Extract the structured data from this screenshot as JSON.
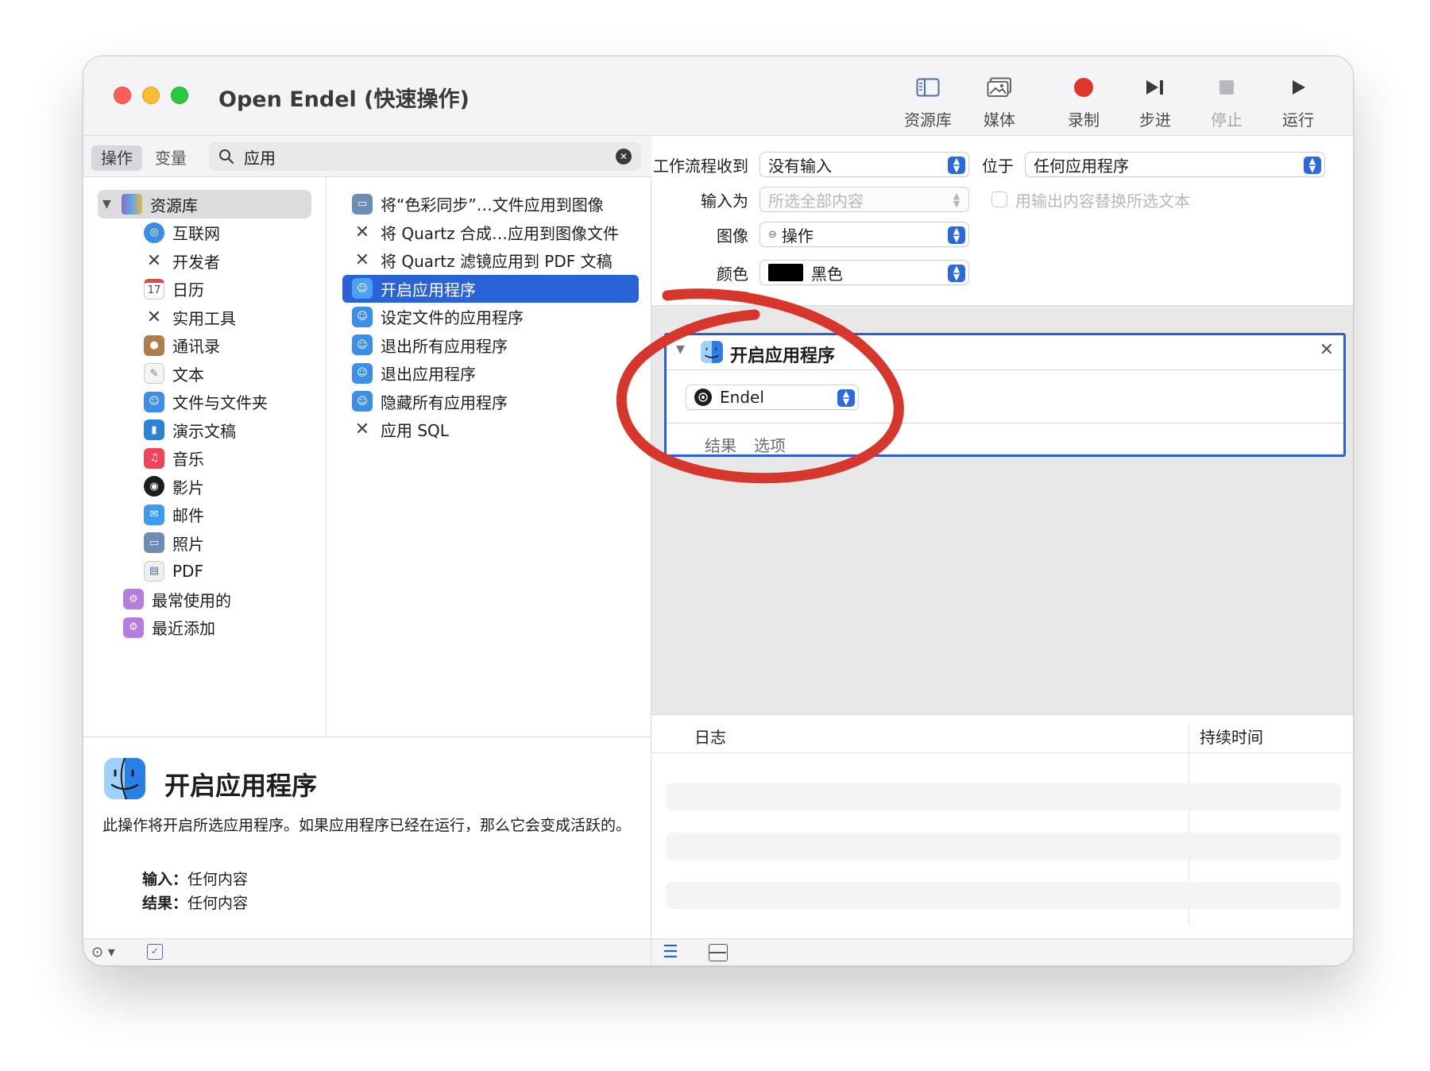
{
  "window": {
    "title": "Open Endel (快速操作)"
  },
  "toolbar": {
    "library": "资源库",
    "media": "媒体",
    "record": "录制",
    "step": "步进",
    "stop": "停止",
    "run": "运行"
  },
  "search": {
    "tab_actions": "操作",
    "tab_variables": "变量",
    "value": "应用",
    "placeholder": ""
  },
  "categories": {
    "root": "资源库",
    "items": [
      "互联网",
      "开发者",
      "日历",
      "实用工具",
      "通讯录",
      "文本",
      "文件与文件夹",
      "演示文稿",
      "音乐",
      "影片",
      "邮件",
      "照片",
      "PDF"
    ],
    "calendar_day": "17",
    "folders": [
      "最常使用的",
      "最近添加"
    ]
  },
  "actions": [
    "将“色彩同步”…文件应用到图像",
    "将 Quartz 合成…应用到图像文件",
    "将 Quartz 滤镜应用到 PDF 文稿",
    "开启应用程序",
    "设定文件的应用程序",
    "退出所有应用程序",
    "退出应用程序",
    "隐藏所有应用程序",
    "应用 SQL"
  ],
  "description": {
    "title": "开启应用程序",
    "body": "此操作将开启所选应用程序。如果应用程序已经在运行，那么它会变成活跃的。",
    "input_label": "输入：",
    "input_value": "任何内容",
    "result_label": "结果：",
    "result_value": "任何内容"
  },
  "workflow": {
    "receives_label": "工作流程收到",
    "receives_value": "没有输入",
    "in_label": "位于",
    "in_value": "任何应用程序",
    "input_is_label": "输入为",
    "input_is_value": "所选全部内容",
    "replace_label": "用输出内容替换所选文本",
    "image_label": "图像",
    "image_value": "操作",
    "color_label": "颜色",
    "color_value": "黑色"
  },
  "card": {
    "title": "开启应用程序",
    "app": "Endel",
    "tab_results": "结果",
    "tab_options": "选项"
  },
  "log": {
    "col_log": "日志",
    "col_duration": "持续时间"
  },
  "colors": {
    "accent": "#2a63d8",
    "annotation": "#d6362b",
    "card_border": "#2b5fd6"
  }
}
